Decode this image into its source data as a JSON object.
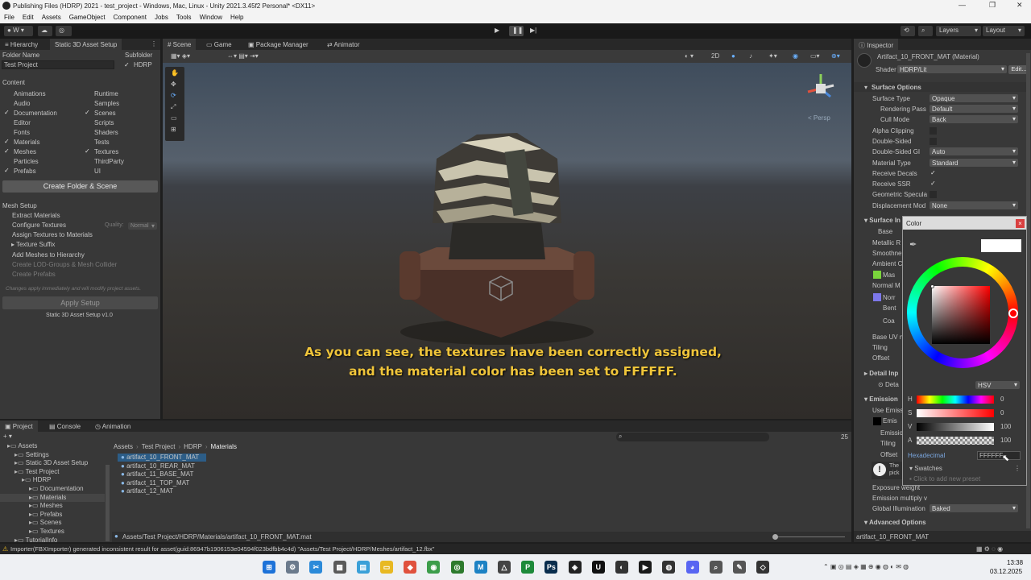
{
  "window": {
    "title": "Publishing Files (HDRP) 2021 - test_project - Windows, Mac, Linux - Unity 2021.3.45f2 Personal* <DX11>"
  },
  "menu": [
    "File",
    "Edit",
    "Assets",
    "GameObject",
    "Component",
    "Jobs",
    "Tools",
    "Window",
    "Help"
  ],
  "toolbar": {
    "account": "W",
    "layers": "Layers",
    "layout": "Layout"
  },
  "left_panel": {
    "tabs": [
      "Hierarchy",
      "Static 3D Asset Setup"
    ],
    "folder_name_label": "Folder Name",
    "folder_name_value": "Test Project",
    "subfolder_label": "Subfolder",
    "subfolder_value": "HDRP",
    "content_label": "Content",
    "content_col1": [
      {
        "label": "Animations",
        "checked": false
      },
      {
        "label": "Audio",
        "checked": false
      },
      {
        "label": "Documentation",
        "checked": true
      },
      {
        "label": "Editor",
        "checked": false
      },
      {
        "label": "Fonts",
        "checked": false
      },
      {
        "label": "Materials",
        "checked": true
      },
      {
        "label": "Meshes",
        "checked": true
      },
      {
        "label": "Particles",
        "checked": false
      },
      {
        "label": "Prefabs",
        "checked": true
      }
    ],
    "content_col2": [
      {
        "label": "Runtime",
        "checked": false
      },
      {
        "label": "Samples",
        "checked": false
      },
      {
        "label": "Scenes",
        "checked": true
      },
      {
        "label": "Scripts",
        "checked": false
      },
      {
        "label": "Shaders",
        "checked": false
      },
      {
        "label": "Tests",
        "checked": false
      },
      {
        "label": "Textures",
        "checked": true
      },
      {
        "label": "ThirdParty",
        "checked": false
      },
      {
        "label": "UI",
        "checked": false
      }
    ],
    "create_button": "Create Folder & Scene",
    "mesh_setup_label": "Mesh Setup",
    "mesh_options": {
      "extract": "Extract Materials",
      "configure": "Configure Textures",
      "quality_label": "Quality:",
      "quality_value": "Normal",
      "assign": "Assign Textures to Materials",
      "suffix": "Texture Suffix",
      "add_meshes": "Add Meshes to Hierarchy",
      "create_lod": "Create LOD-Groups & Mesh Collider",
      "create_prefabs": "Create Prefabs"
    },
    "note": "Changes apply immediately and will modify project assets.",
    "apply_button": "Apply Setup",
    "version": "Static 3D Asset Setup v1.0"
  },
  "scene": {
    "tabs": [
      "Scene",
      "Game",
      "Package Manager",
      "Animator"
    ],
    "mode_2d": "2D",
    "persp": "< Persp",
    "subtitle_line1": "As you can see, the textures have been correctly assigned,",
    "subtitle_line2": "and the material color has been set to FFFFFF."
  },
  "project": {
    "tabs": [
      "Project",
      "Console",
      "Animation"
    ],
    "tree": [
      "Assets",
      "Settings",
      "Static 3D Asset Setup",
      "Test Project",
      "HDRP",
      "Documentation",
      "Materials",
      "Meshes",
      "Prefabs",
      "Scenes",
      "Textures",
      "TutorialInfo"
    ],
    "breadcrumb": [
      "Assets",
      "Test Project",
      "HDRP",
      "Materials"
    ],
    "files": [
      "artifact_10_FRONT_MAT",
      "artifact_10_REAR_MAT",
      "artifact_11_BASE_MAT",
      "artifact_11_TOP_MAT",
      "artifact_12_MAT"
    ],
    "count": "25",
    "selected_path": "Assets/Test Project/HDRP/Materials/artifact_10_FRONT_MAT.mat"
  },
  "inspector": {
    "tab": "Inspector",
    "material_name": "Artifact_10_FRONT_MAT (Material)",
    "shader_label": "Shader",
    "shader_value": "HDRP/Lit",
    "edit_button": "Edit...",
    "surface_options_header": "Surface Options",
    "surface_props": [
      {
        "label": "Surface Type",
        "value": "Opaque"
      },
      {
        "label": "Rendering Pass",
        "value": "Default"
      },
      {
        "label": "Cull Mode",
        "value": "Back"
      }
    ],
    "alpha_clipping": "Alpha Clipping",
    "double_sided": "Double-Sided",
    "double_sided_gi_label": "Double-Sided GI",
    "double_sided_gi_value": "Auto",
    "material_type_label": "Material Type",
    "material_type_value": "Standard",
    "receive_decals": "Receive Decals",
    "receive_ssr": "Receive SSR",
    "geometric_specular": "Geometric Specula",
    "displacement_label": "Displacement Mod",
    "displacement_value": "None",
    "surface_inputs_header": "Surface In",
    "surface_input_labels": [
      "Base",
      "Metallic R",
      "Smoothne",
      "Ambient C",
      "Mas",
      "Normal M",
      "Norr",
      "Bent",
      "Coa",
      "Base UV n",
      "Tiling",
      "Offset"
    ],
    "detail_header": "Detail Inp",
    "detail_sub": "Deta",
    "emission_header": "Emission",
    "emission_labels": [
      "Use Emiss",
      "Emis",
      "Emissio",
      "Tiling",
      "Offset"
    ],
    "warning_text": [
      "The",
      "pick"
    ],
    "exposure_weight": "Exposure weight",
    "emission_multiply": "Emission multiply v",
    "global_illumination_label": "Global Illumination",
    "global_illumination_value": "Baked",
    "advanced_header": "Advanced Options",
    "footer_name": "artifact_10_FRONT_MAT"
  },
  "color_picker": {
    "title": "Color",
    "mode": "HSV",
    "channels": [
      {
        "label": "H",
        "value": "0"
      },
      {
        "label": "S",
        "value": "0"
      },
      {
        "label": "V",
        "value": "100"
      },
      {
        "label": "A",
        "value": "100"
      }
    ],
    "hex_label": "Hexadecimal",
    "hex_value": "FFFFFF",
    "swatches_label": "Swatches",
    "add_preset": "Click to add new preset"
  },
  "status": {
    "message": "Importer(FBXImporter) generated inconsistent result for asset(guid:86947b1906153e04594f023bdfbb4c4d) \"Assets/Test Project/HDRP/Meshes/artifact_12.fbx\""
  },
  "taskbar": {
    "time": "13:38",
    "date": "03.12.2025"
  },
  "colors": {
    "accent": "#4a89dc",
    "subtitle": "#f0c53a",
    "warning": "#e8b923"
  }
}
